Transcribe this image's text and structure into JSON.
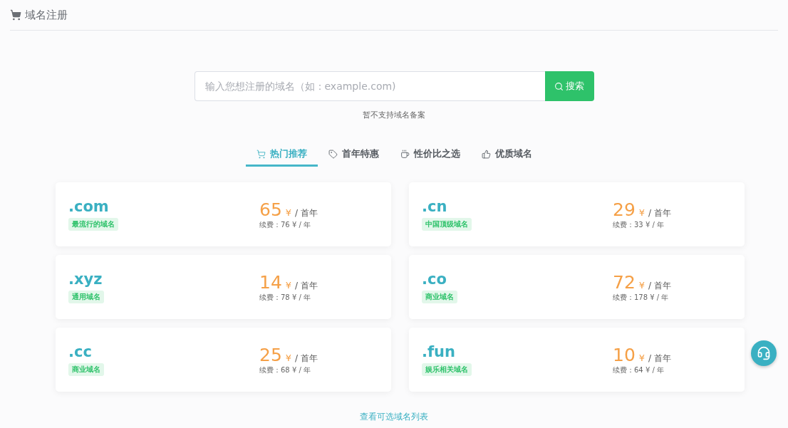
{
  "header": {
    "title": "域名注册"
  },
  "search": {
    "placeholder": "输入您想注册的域名（如：example.com)",
    "button": "搜索",
    "note": "暂不支持域名备案"
  },
  "tabs": [
    {
      "label": "热门推荐",
      "kind": "hot",
      "selected": true
    },
    {
      "label": "首年特惠",
      "kind": "deal",
      "selected": false
    },
    {
      "label": "性价比之选",
      "kind": "value",
      "selected": false
    },
    {
      "label": "优质域名",
      "kind": "premium",
      "selected": false
    }
  ],
  "domains": [
    {
      "name": ".com",
      "tag": "最流行的域名",
      "price": "65",
      "currency": "¥",
      "unit": "/ 首年",
      "renewal": "续费：76 ¥ / 年"
    },
    {
      "name": ".cn",
      "tag": "中国顶级域名",
      "price": "29",
      "currency": "¥",
      "unit": "/ 首年",
      "renewal": "续费：33 ¥ / 年"
    },
    {
      "name": ".xyz",
      "tag": "通用域名",
      "price": "14",
      "currency": "¥",
      "unit": "/ 首年",
      "renewal": "续费：78 ¥ / 年"
    },
    {
      "name": ".co",
      "tag": "商业域名",
      "price": "72",
      "currency": "¥",
      "unit": "/ 首年",
      "renewal": "续费：178 ¥ / 年"
    },
    {
      "name": ".cc",
      "tag": "商业域名",
      "price": "25",
      "currency": "¥",
      "unit": "/ 首年",
      "renewal": "续费：68 ¥ / 年"
    },
    {
      "name": ".fun",
      "tag": "娱乐相关域名",
      "price": "10",
      "currency": "¥",
      "unit": "/ 首年",
      "renewal": "续费：64 ¥ / 年"
    }
  ],
  "footer_link": "查看可选域名列表"
}
